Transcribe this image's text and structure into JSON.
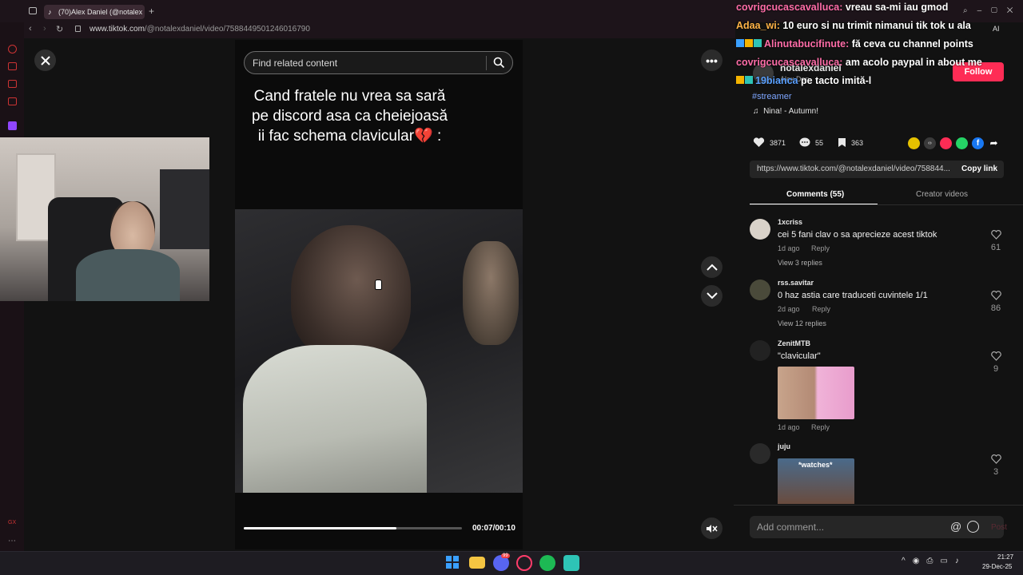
{
  "browser": {
    "tab_title": "(70)Alex Daniel (@notalex",
    "url_host": "www.tiktok.com",
    "url_path": "/@notalexdaniel/video/7588449501246016790"
  },
  "video": {
    "search_placeholder": "Find related content",
    "caption": "Cand fratele nu vrea sa sară pe discord asa ca cheiejoasă ii fac schema clavicular💔 :",
    "time": "00:07/00:10",
    "progress": 0.7
  },
  "chat": [
    {
      "name": "covrigcucascavalluca:",
      "text": "vreau sa-mi iau gmod",
      "badges": ""
    },
    {
      "name": "Adaa_wi:",
      "text": "10 euro si nu trimit nimanui tik tok u ala",
      "badges": ""
    },
    {
      "name": "Alinutabucifinute:",
      "text": "fă ceva cu channel points",
      "badges": "badges"
    },
    {
      "name": "covrigcucascavalluca:",
      "text": "am acolo paypal in about me",
      "badges": ""
    },
    {
      "name": "19bianca",
      "text": "pe tacto imită-l",
      "badges": "badges"
    }
  ],
  "post": {
    "author": "notalexdaniel",
    "author_sub": "Alex Dan",
    "follow_label": "Follow",
    "hashtag": "#streamer",
    "music": "Nina! - Autumn!",
    "likes": "3871",
    "comments": "55",
    "saves": "363",
    "link": "https://www.tiktok.com/@notalexdaniel/video/758844...",
    "copy_label": "Copy link"
  },
  "tabs": {
    "comments_label": "Comments (55)",
    "creator_label": "Creator videos"
  },
  "comments": [
    {
      "user": "1xcriss",
      "text": "cei 5 fani clav o sa aprecieze acest tiktok",
      "age": "1d ago",
      "reply": "Reply",
      "likes": "61",
      "replies": "View 3 replies"
    },
    {
      "user": "rss.savitar",
      "text": "0 haz astia care traduceti cuvintele 1/1",
      "age": "2d ago",
      "reply": "Reply",
      "likes": "86",
      "replies": "View 12 replies"
    },
    {
      "user": "ZenitMTB",
      "text": "\"clavicular\"",
      "age": "1d ago",
      "reply": "Reply",
      "likes": "9",
      "replies": ""
    },
    {
      "user": "juju",
      "text": "",
      "age": "",
      "reply": "",
      "likes": "3",
      "replies": "",
      "image_text": "*watches*"
    }
  ],
  "add_comment": {
    "placeholder": "Add comment...",
    "post_label": "Post"
  },
  "sidebar_bottom_label": "GX",
  "addr_ai": "AI",
  "taskbar": {
    "time": "21:27",
    "date": "29-Dec-25",
    "discord_badge": "99"
  },
  "colors": {
    "follow": "#fe2c55",
    "accent_pink": "#ff6da8",
    "hashtag": "#7ea6ff",
    "chat_name_orange": "#ffb347"
  }
}
